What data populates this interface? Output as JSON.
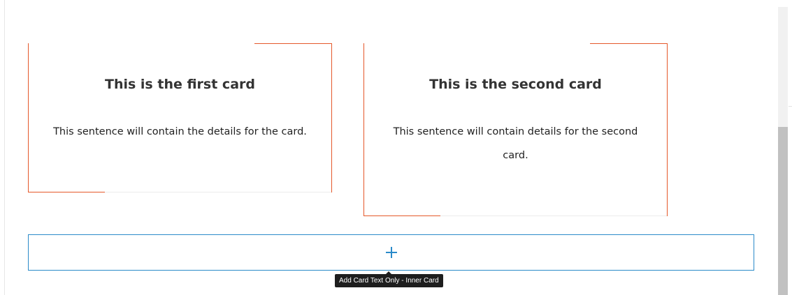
{
  "cards": [
    {
      "title": "This is the first card",
      "text": "This sentence will contain the details for the card."
    },
    {
      "title": "This is the second card",
      "text": "This sentence will contain details for the second card."
    }
  ],
  "appender": {
    "icon": "plus-icon",
    "tooltip": "Add Card Text Only - Inner Card"
  },
  "colors": {
    "accent": "#e5582a",
    "appender_border": "#2a8ac9",
    "tooltip_bg": "#1e1e1e",
    "scrollbar_thumb": "#c1c1c1"
  }
}
